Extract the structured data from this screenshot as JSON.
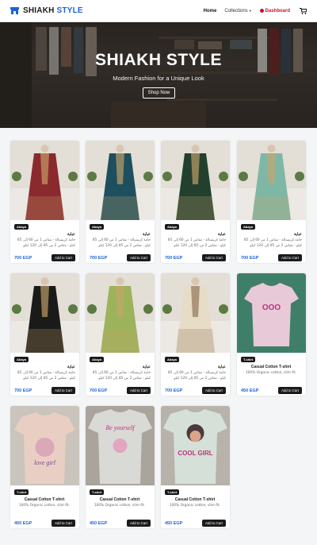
{
  "brand": {
    "word1": "SHIAKH",
    "word2": "STYLE"
  },
  "nav": {
    "home": "Home",
    "collections": "Collections",
    "dashboard": "Dashboard"
  },
  "hero": {
    "title": "SHIAKH STYLE",
    "subtitle": "Modern Fashion for a Unique Look",
    "cta": "Shop Now"
  },
  "products": [
    {
      "badge": "Abaya",
      "name": "عباية",
      "desc": "خامة كريستالة - مقاس 1 من 60 إلى 85 كيلو - مقاس 2 من 85 إلى 120 كيلو",
      "price": "700 EGP",
      "cta": "Add to Cart",
      "color": "#8a2a2e"
    },
    {
      "badge": "Abaya",
      "name": "عباية",
      "desc": "خامة كريستالة - مقاس 1 من 60 إلى 85 كيلو - مقاس 2 من 85 إلى 120 كيلو",
      "price": "700 EGP",
      "cta": "Add to Cart",
      "color": "#1d4f5e"
    },
    {
      "badge": "Abaya",
      "name": "عباية",
      "desc": "خامة كريستالة - مقاس 1 من 60 إلى 85 كيلو - مقاس 2 من 85 إلى 120 كيلو",
      "price": "700 EGP",
      "cta": "Add to Cart",
      "color": "#23402f"
    },
    {
      "badge": "Abaya",
      "name": "عباية",
      "desc": "خامة كريستالة - مقاس 1 من 60 إلى 85 كيلو - مقاس 2 من 85 إلى 120 كيلو",
      "price": "700 EGP",
      "cta": "Add to Cart",
      "color": "#7fb7a6"
    },
    {
      "badge": "Abaya",
      "name": "عباية",
      "desc": "خامة كريستالة - مقاس 1 من 60 إلى 85 كيلو - مقاس 2 من 85 إلى 120 كيلو",
      "price": "700 EGP",
      "cta": "Add to Cart",
      "color": "#1a1a1a"
    },
    {
      "badge": "Abaya",
      "name": "عباية",
      "desc": "خامة كريستالة - مقاس 1 من 60 إلى 85 كيلو - مقاس 2 من 85 إلى 120 كيلو",
      "price": "700 EGP",
      "cta": "Add to Cart",
      "color": "#9bb35a"
    },
    {
      "badge": "Abaya",
      "name": "عباية",
      "desc": "خامة كريستالة - مقاس 1 من 60 إلى 85 كيلو - مقاس 2 من 85 إلى 120 كيلو",
      "price": "700 EGP",
      "cta": "Add to Cart",
      "color": "#e7dcc6"
    },
    {
      "badge": "T-shirt",
      "name": "Casual Cotton T-shirt",
      "desc": "100% Organic cotton, slim fit.",
      "price": "450 EGP",
      "cta": "Add to Cart",
      "color": "#e7c9d8",
      "art": "OOO"
    },
    {
      "badge": "T-shirt",
      "name": "Casual Cotton T-shirt",
      "desc": "100% Organic cotton, slim fit.",
      "price": "450 EGP",
      "cta": "Add to Cart",
      "color": "#e9cfc3",
      "art": "love girl"
    },
    {
      "badge": "T-shirt",
      "name": "Casual Cotton T-shirt",
      "desc": "100% Organic cotton, slim fit.",
      "price": "450 EGP",
      "cta": "Add to Cart",
      "color": "#d9d9d6",
      "art": "Be yourself"
    },
    {
      "badge": "T-shirt",
      "name": "Casual Cotton T-shirt",
      "desc": "100% Organic cotton, slim fit.",
      "price": "450 EGP",
      "cta": "Add to Cart",
      "color": "#d5e0d8",
      "art": "COOL GIRL"
    }
  ]
}
